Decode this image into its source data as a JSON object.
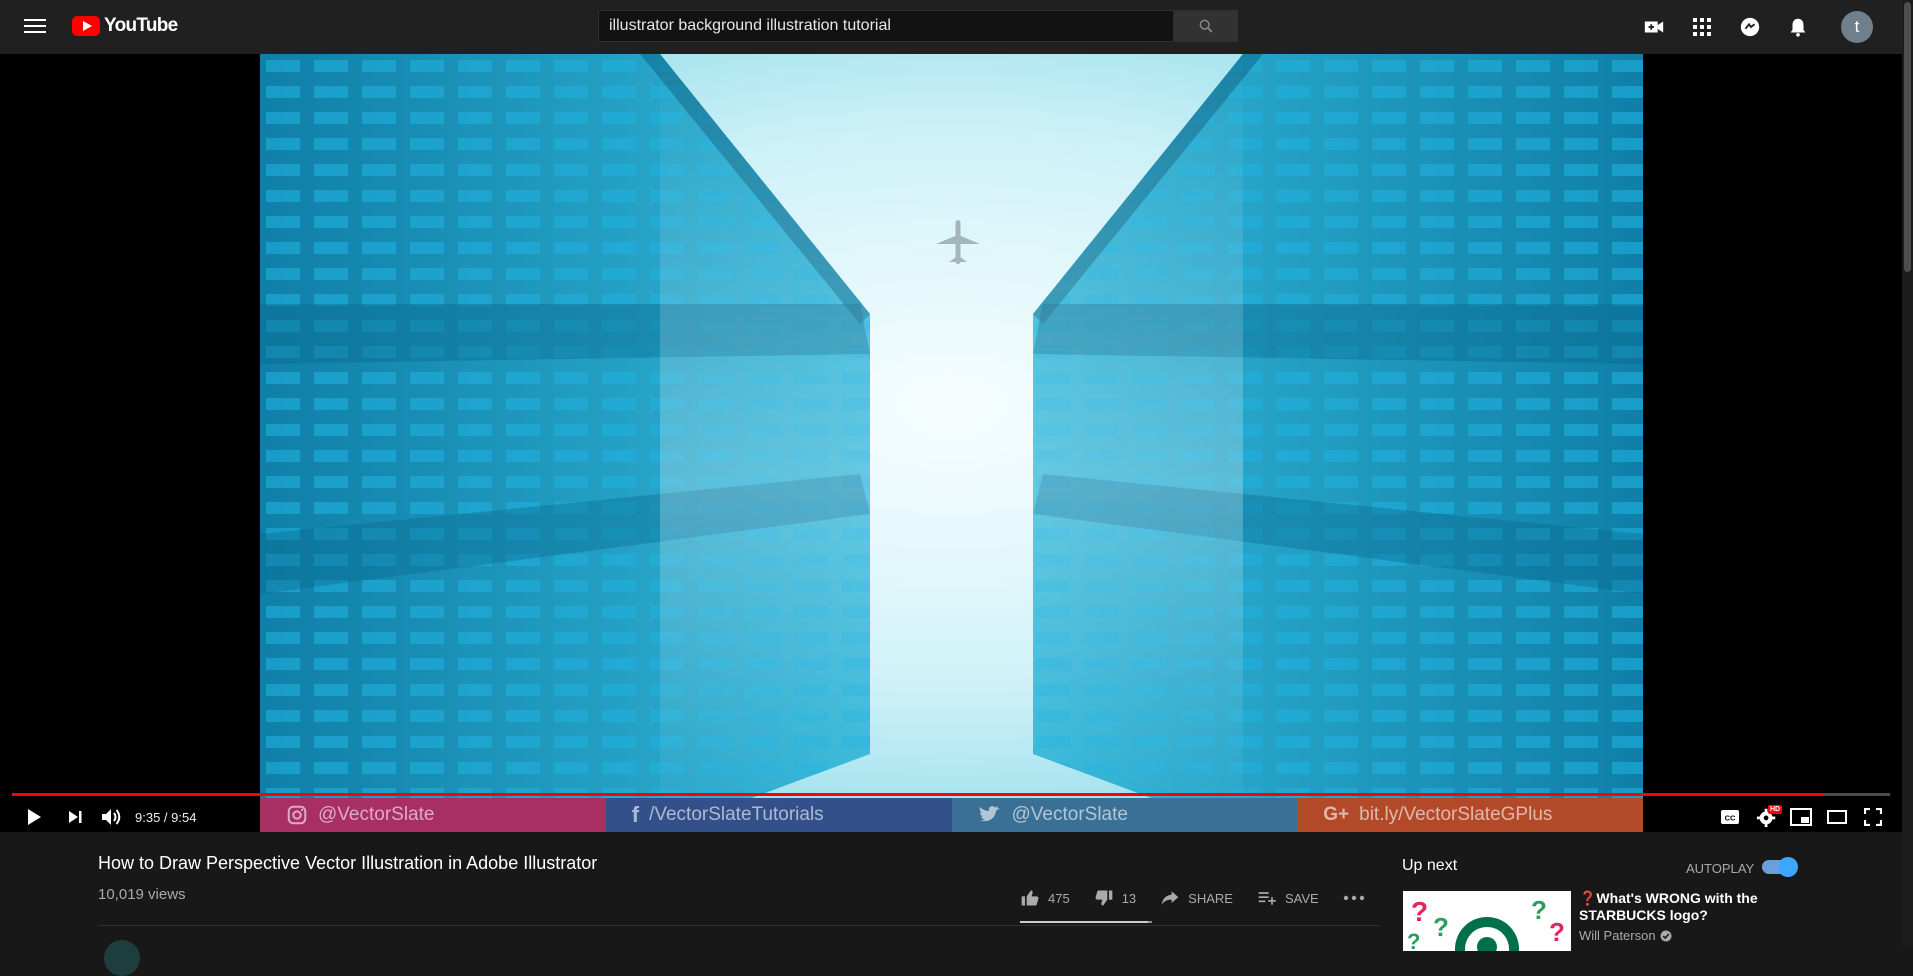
{
  "header": {
    "logo_text": "YouTube",
    "search_value": "illustrator background illustration tutorial",
    "avatar_letter": "t"
  },
  "player": {
    "time_display": "9:35 / 9:54",
    "progress_fraction": 0.965,
    "social": [
      {
        "icon": "instagram-icon",
        "text": "@VectorSlate",
        "color": "#a82f63"
      },
      {
        "icon": "facebook-icon",
        "text": "/VectorSlateTutorials",
        "color": "#33508a"
      },
      {
        "icon": "twitter-icon",
        "text": "@VectorSlate",
        "color": "#3a6f96"
      },
      {
        "icon": "google-plus-icon",
        "text": "bit.ly/VectorSlateGPlus",
        "color": "#b24a2a"
      }
    ],
    "hd_badge": "HD"
  },
  "video_info": {
    "title": "How to Draw Perspective Vector Illustration in Adobe Illustrator",
    "views": "10,019 views",
    "likes": "475",
    "dislikes": "13",
    "share_label": "SHARE",
    "save_label": "SAVE",
    "like_fraction": 0.973
  },
  "sidebar": {
    "up_next_label": "Up next",
    "autoplay_label": "AUTOPLAY",
    "autoplay_on": true,
    "recommendation": {
      "title": "❓What's WRONG with the STARBUCKS logo?",
      "channel": "Will Paterson"
    }
  },
  "colors": {
    "accent_red": "#ff0000",
    "toggle_blue": "#3ea6ff"
  }
}
